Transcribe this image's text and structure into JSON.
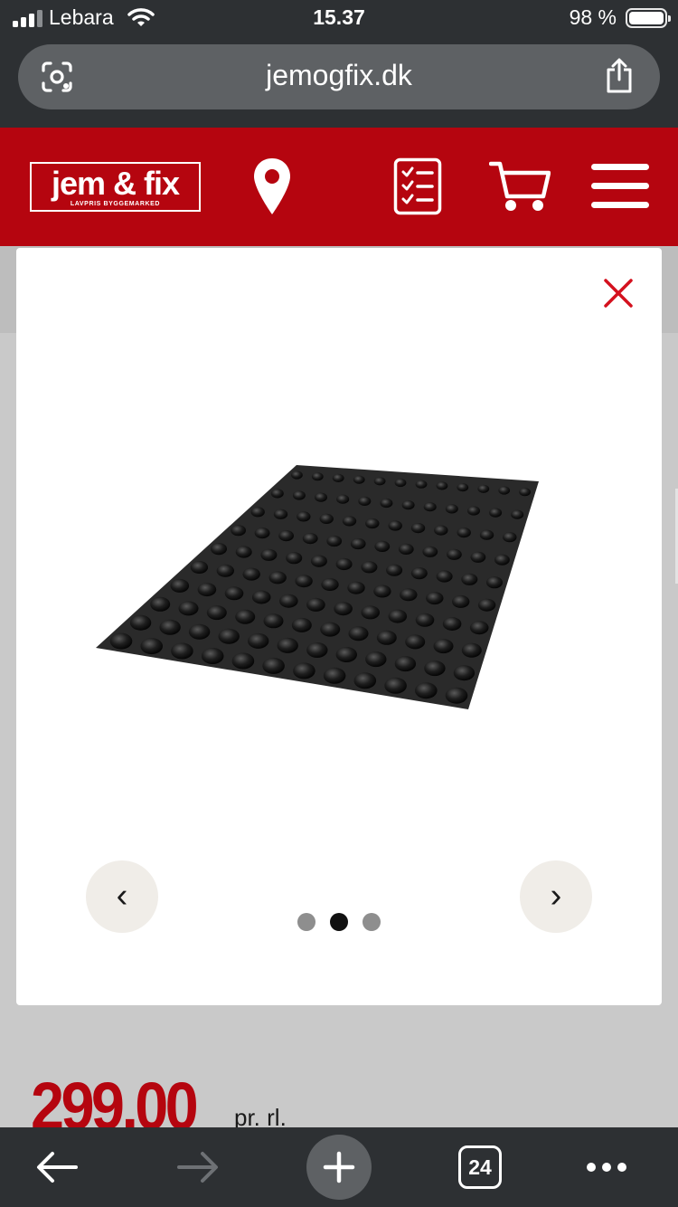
{
  "status_bar": {
    "carrier": "Lebara",
    "time": "15.37",
    "battery": "98 %"
  },
  "browser": {
    "url": "jemogfix.dk",
    "open_tabs": "24"
  },
  "site": {
    "logo_name": "jem & fix",
    "logo_tagline": "LAVPRIS BYGGEMARKED",
    "brand_color": "#b5050f"
  },
  "gallery": {
    "prev_label": "‹",
    "next_label": "›",
    "image_count": 3,
    "active_index": 1
  },
  "product": {
    "price": "299,00",
    "unit": "pr. rl."
  },
  "icons": {
    "header": [
      "location-pin-icon",
      "shopping-list-icon",
      "cart-icon",
      "menu-icon"
    ],
    "toolbar": [
      "back-arrow-icon",
      "forward-arrow-icon",
      "plus-icon",
      "tabs-icon",
      "more-icon"
    ]
  }
}
